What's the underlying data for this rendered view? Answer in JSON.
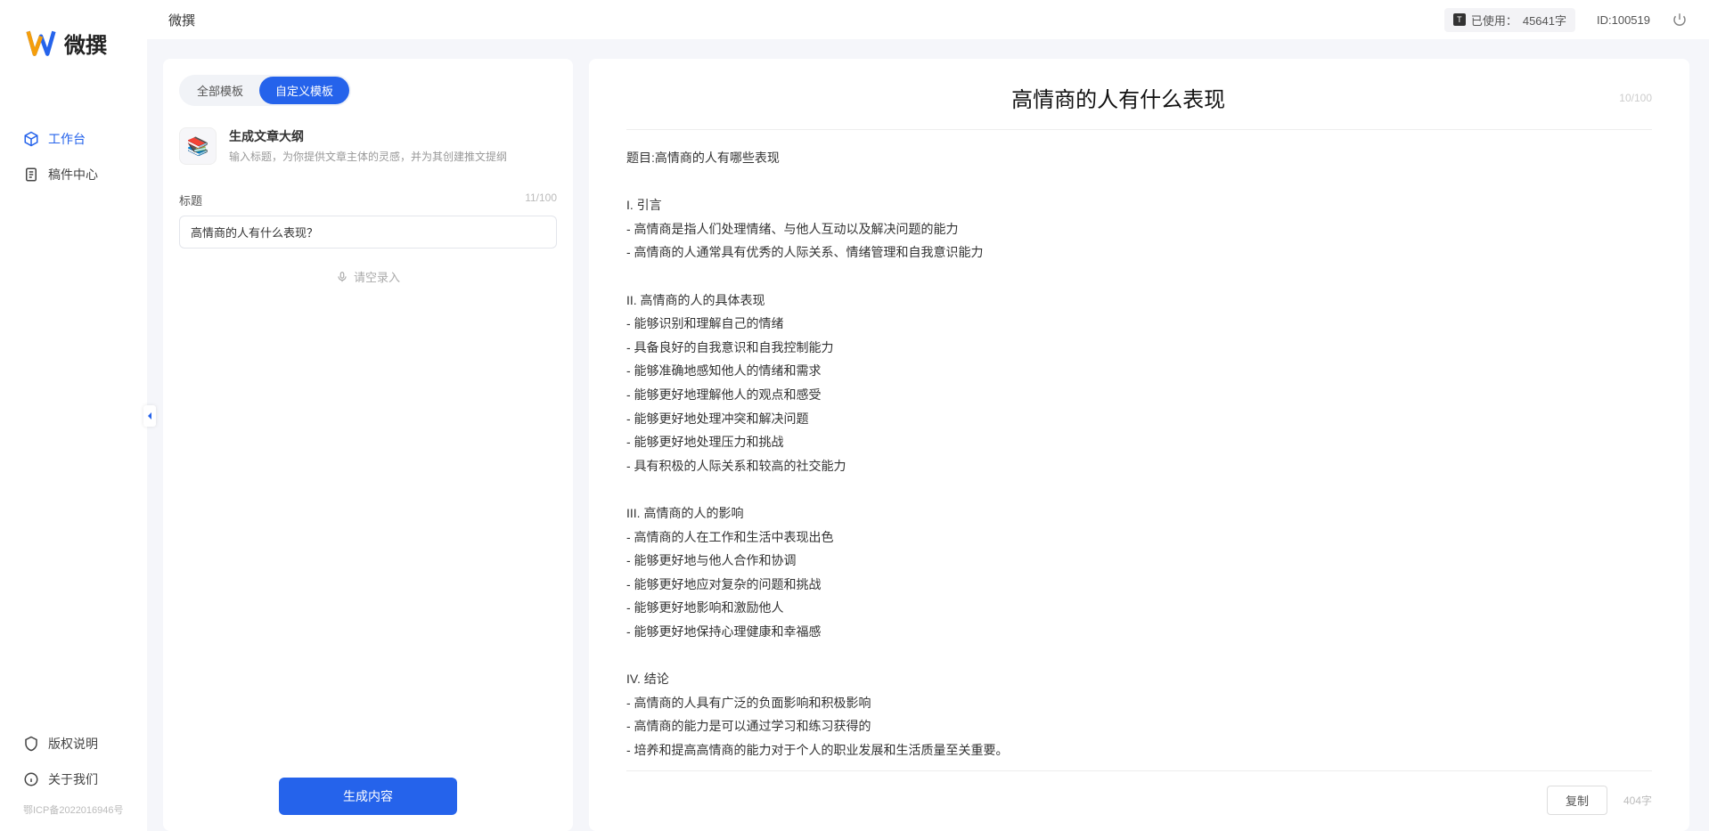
{
  "logo": {
    "text": "微撰"
  },
  "sidebar": {
    "items": [
      {
        "label": "工作台"
      },
      {
        "label": "稿件中心"
      }
    ],
    "bottom_items": [
      {
        "label": "版权说明"
      },
      {
        "label": "关于我们"
      }
    ],
    "icp": "鄂ICP备2022016946号"
  },
  "topbar": {
    "title": "微撰",
    "usage_prefix": "已使用：",
    "usage_value": "45641字",
    "id_label": "ID:100519"
  },
  "left": {
    "tabs": [
      "全部模板",
      "自定义模板"
    ],
    "template": {
      "title": "生成文章大纲",
      "desc": "输入标题，为你提供文章主体的灵感，并为其创建推文提纲"
    },
    "form": {
      "label": "标题",
      "count": "11/100",
      "value": "高情商的人有什么表现？"
    },
    "voice_hint": "请空录入",
    "generate_btn": "生成内容"
  },
  "output": {
    "title": "高情商的人有什么表现",
    "title_count": "10/100",
    "body": "题目:高情商的人有哪些表现\n\nI. 引言\n- 高情商是指人们处理情绪、与他人互动以及解决问题的能力\n- 高情商的人通常具有优秀的人际关系、情绪管理和自我意识能力\n\nII. 高情商的人的具体表现\n- 能够识别和理解自己的情绪\n- 具备良好的自我意识和自我控制能力\n- 能够准确地感知他人的情绪和需求\n- 能够更好地理解他人的观点和感受\n- 能够更好地处理冲突和解决问题\n- 能够更好地处理压力和挑战\n- 具有积极的人际关系和较高的社交能力\n\nIII. 高情商的人的影响\n- 高情商的人在工作和生活中表现出色\n- 能够更好地与他人合作和协调\n- 能够更好地应对复杂的问题和挑战\n- 能够更好地影响和激励他人\n- 能够更好地保持心理健康和幸福感\n\nIV. 结论\n- 高情商的人具有广泛的负面影响和积极影响\n- 高情商的能力是可以通过学习和练习获得的\n- 培养和提高高情商的能力对于个人的职业发展和生活质量至关重要。",
    "copy_btn": "复制",
    "word_count": "404字"
  }
}
